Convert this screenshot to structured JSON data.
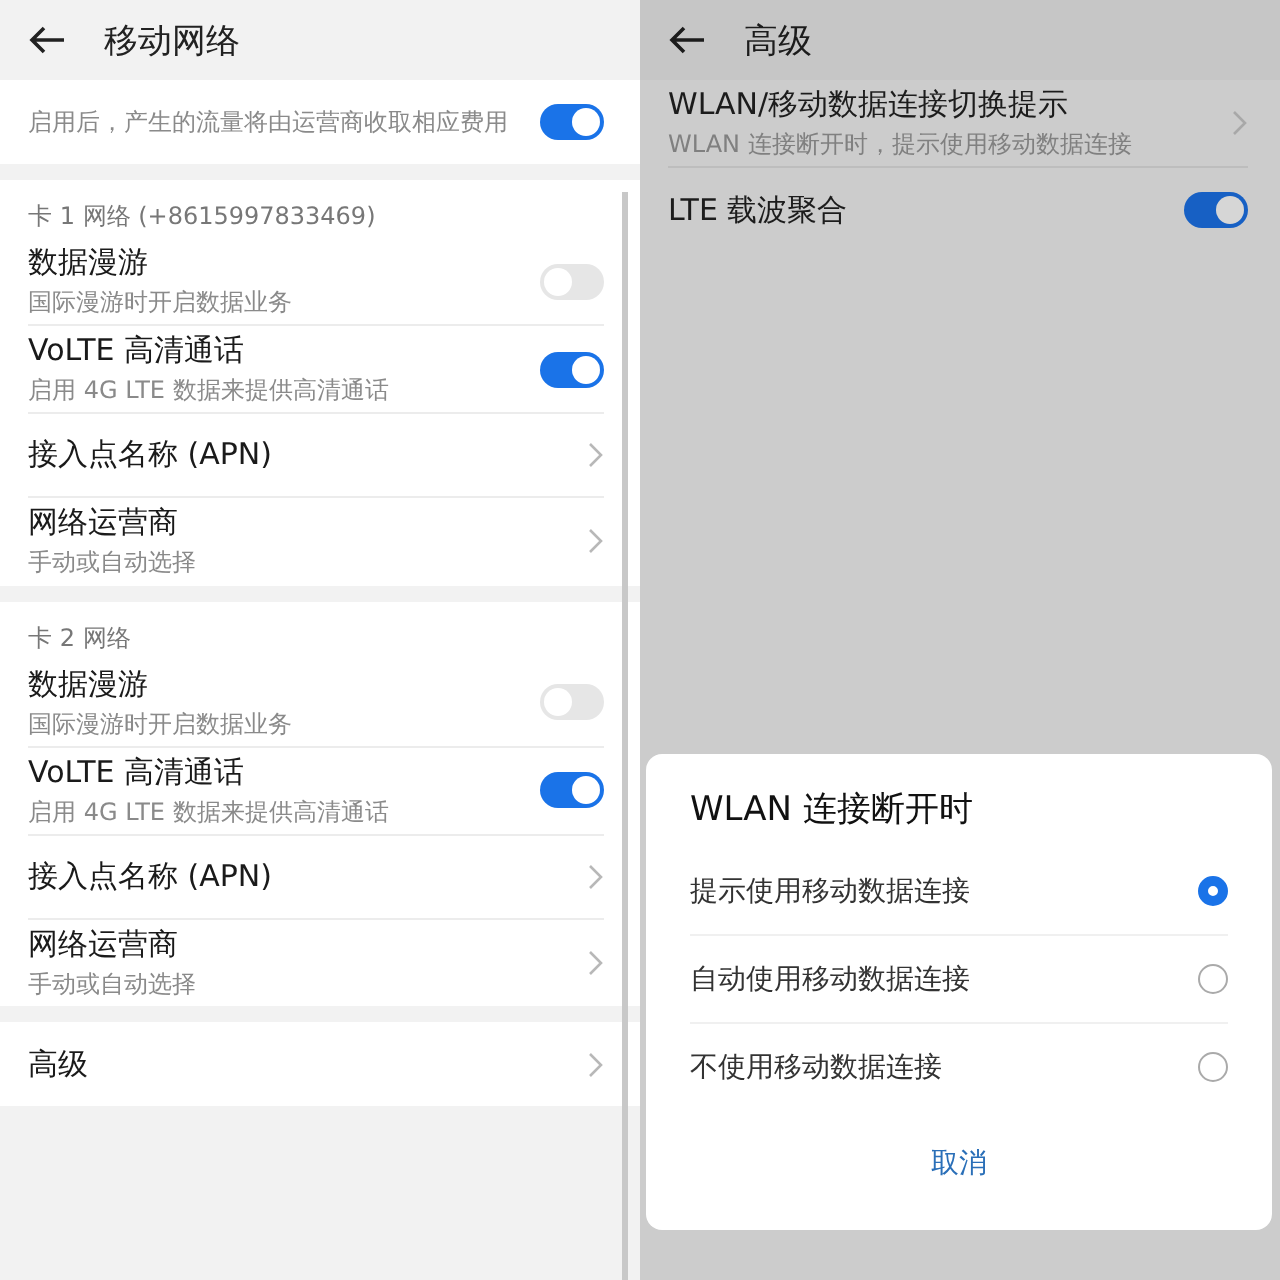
{
  "left_screen": {
    "title": "移动网络",
    "sections": [
      {
        "items": [
          {
            "kind": "toggle",
            "subtitle": "启用后，产生的流量将由运营商收取相应费用",
            "on": true
          }
        ]
      },
      {
        "header": "卡 1 网络 (+8615997833469)",
        "items": [
          {
            "kind": "toggle",
            "title": "数据漫游",
            "subtitle": "国际漫游时开启数据业务",
            "on": false
          },
          {
            "kind": "toggle",
            "title": "VoLTE 高清通话",
            "subtitle": "启用 4G LTE 数据来提供高清通话",
            "on": true
          },
          {
            "kind": "link",
            "title": "接入点名称 (APN)"
          },
          {
            "kind": "link",
            "title": "网络运营商",
            "subtitle": "手动或自动选择"
          }
        ]
      },
      {
        "header": "卡 2 网络",
        "items": [
          {
            "kind": "toggle",
            "title": "数据漫游",
            "subtitle": "国际漫游时开启数据业务",
            "on": false
          },
          {
            "kind": "toggle",
            "title": "VoLTE 高清通话",
            "subtitle": "启用 4G LTE 数据来提供高清通话",
            "on": true
          },
          {
            "kind": "link",
            "title": "接入点名称 (APN)"
          },
          {
            "kind": "link",
            "title": "网络运营商",
            "subtitle": "手动或自动选择"
          }
        ]
      },
      {
        "items": [
          {
            "kind": "link",
            "title": "高级"
          }
        ]
      }
    ]
  },
  "right_screen": {
    "title": "高级",
    "items": [
      {
        "kind": "link",
        "title": "WLAN/移动数据连接切换提示",
        "subtitle": "WLAN 连接断开时，提示使用移动数据连接"
      },
      {
        "kind": "toggle",
        "title": "LTE 载波聚合",
        "on": true
      }
    ],
    "dialog": {
      "title": "WLAN 连接断开时",
      "options": [
        {
          "label": "提示使用移动数据连接",
          "selected": true
        },
        {
          "label": "自动使用移动数据连接",
          "selected": false
        },
        {
          "label": "不使用移动数据连接",
          "selected": false
        }
      ],
      "cancel": "取消"
    }
  }
}
